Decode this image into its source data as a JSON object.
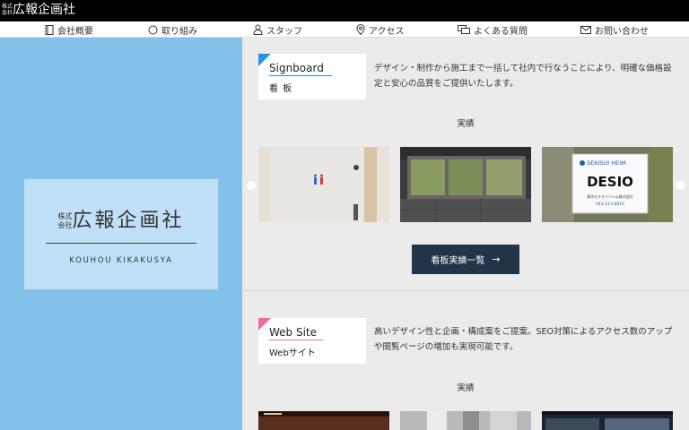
{
  "brand": {
    "kabu": "株式会社",
    "name": "広報企画社",
    "roman": "KOUHOU KIKAKUSYA"
  },
  "nav": {
    "items": [
      {
        "label": "会社概要",
        "icon": "book-icon"
      },
      {
        "label": "取り組み",
        "icon": "circle-icon"
      },
      {
        "label": "スタッフ",
        "icon": "person-icon"
      },
      {
        "label": "アクセス",
        "icon": "map-pin-icon"
      },
      {
        "label": "よくある質問",
        "icon": "chat-bubbles-icon"
      },
      {
        "label": "お問い合わせ",
        "icon": "envelope-icon"
      }
    ]
  },
  "services": {
    "signboard": {
      "title_en": "Signboard",
      "title_jp": "看 板",
      "description": "デザイン・制作から施工まで一括して社内で行なうことにより、明確な価格設定と安心の品質をご提供いたします。",
      "results_label": "実績",
      "button_label": "看板実績一覧",
      "button_arrow": "→",
      "photos": [
        {
          "alt": "restroom sign on wall"
        },
        {
          "alt": "illuminated window signboard"
        },
        {
          "alt": "SEKISUI HEIM DESIO sign",
          "brand_text": "SEKISUI HEIM",
          "main_text": "DESIO",
          "sub_text": "東京セキスイハイム株式会社",
          "phone": "043-213-6816"
        }
      ]
    },
    "website": {
      "title_en": "Web Site",
      "title_jp": "Webサイト",
      "description": "高いデザイン性と企画・構成案をご提案。SEO対策によるアクセス数のアップや閲覧ページの増加も実現可能です。",
      "results_label": "実績"
    }
  },
  "colors": {
    "accent_blue": "#2496e0",
    "accent_pink": "#f06aa4",
    "left_panel": "#84c2eb",
    "logo_card": "#bfe0f6",
    "button": "#223448"
  }
}
